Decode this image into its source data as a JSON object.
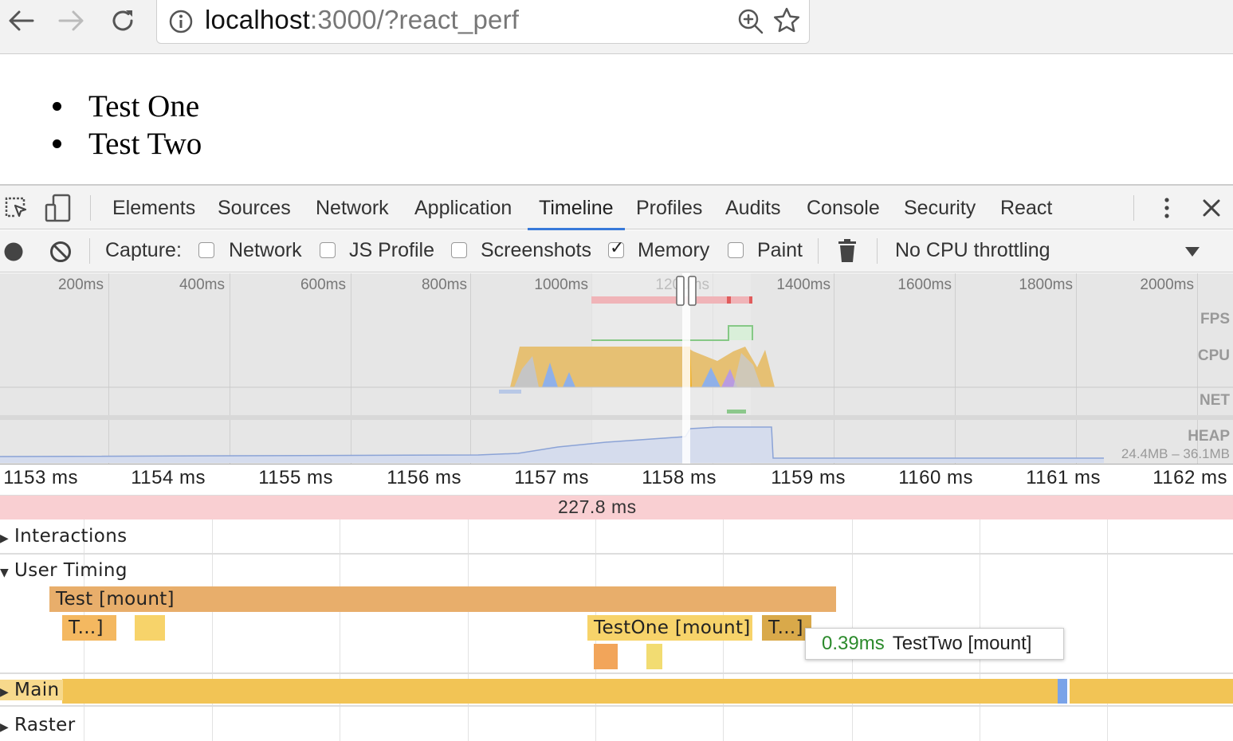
{
  "browser": {
    "url_host": "localhost",
    "url_rest": ":3000/?react_perf",
    "icons": [
      "back-arrow-icon",
      "forward-arrow-icon",
      "reload-icon",
      "info-icon",
      "zoom-icon",
      "star-icon"
    ]
  },
  "page": {
    "items": [
      "Test One",
      "Test Two"
    ]
  },
  "devtools": {
    "tabs": [
      "Elements",
      "Sources",
      "Network",
      "Application",
      "Timeline",
      "Profiles",
      "Audits",
      "Console",
      "Security",
      "React"
    ],
    "active_tab": "Timeline",
    "toolbar": {
      "capture_label": "Capture:",
      "options": [
        {
          "label": "Network",
          "checked": false
        },
        {
          "label": "JS Profile",
          "checked": false
        },
        {
          "label": "Screenshots",
          "checked": false
        },
        {
          "label": "Memory",
          "checked": true
        },
        {
          "label": "Paint",
          "checked": false
        }
      ],
      "throttling": "No CPU throttling"
    },
    "overview": {
      "ticks": [
        "200ms",
        "400ms",
        "600ms",
        "800ms",
        "1000ms",
        "1200ms",
        "1400ms",
        "1600ms",
        "1800ms",
        "2000ms"
      ],
      "labels": {
        "fps": "FPS",
        "cpu": "CPU",
        "net": "NET",
        "heap": "HEAP"
      },
      "heap_range": "24.4MB – 36.1MB"
    },
    "flame": {
      "ruler": [
        "1153 ms",
        "1154 ms",
        "1155 ms",
        "1156 ms",
        "1157 ms",
        "1158 ms",
        "1159 ms",
        "1160 ms",
        "1161 ms",
        "1162 ms"
      ],
      "frame_duration": "227.8 ms",
      "tracks": {
        "interactions": "Interactions",
        "user_timing": "User Timing",
        "main": "Main",
        "raster": "Raster"
      },
      "user_timing_bars": {
        "test_mount": "Test [mount]",
        "t1": "T...]",
        "testone_mount": "TestOne [mount]",
        "t2": "T...]"
      },
      "tooltip": {
        "duration": "0.39ms",
        "name": "TestTwo [mount]"
      }
    }
  },
  "colors": {
    "accent": "#3879d9",
    "user_timing_main": "#e8ae6b",
    "user_timing_light": "#f7d36a",
    "main_thread": "#f2c455",
    "frames": "#f9cfd2",
    "cpu_scripting": "#e6c073",
    "cpu_rendering": "#8fb0e8"
  }
}
